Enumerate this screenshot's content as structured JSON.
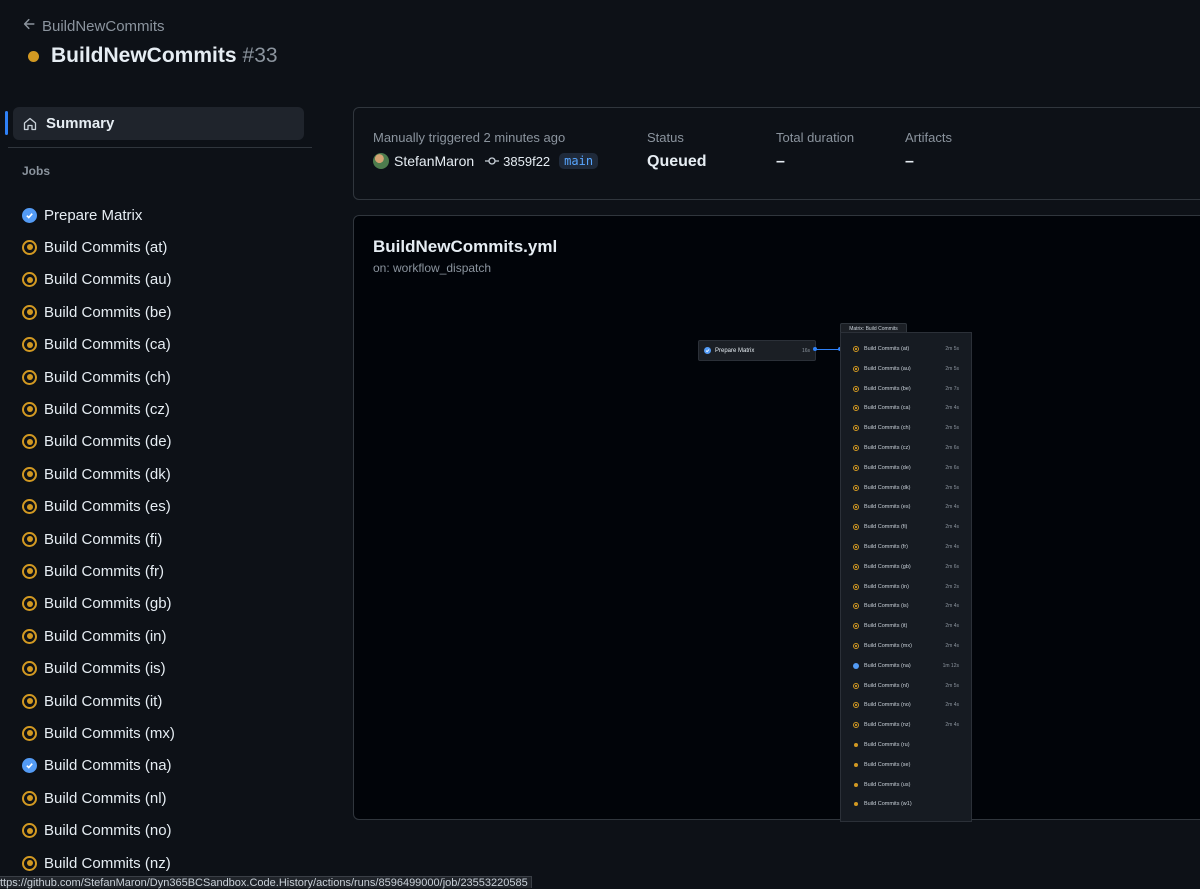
{
  "header": {
    "back_label": "BuildNewCommits",
    "title": "BuildNewCommits",
    "run_number": "#33"
  },
  "sidebar": {
    "summary_label": "Summary",
    "jobs_heading": "Jobs",
    "jobs": [
      {
        "label": "Prepare Matrix",
        "status": "success"
      },
      {
        "label": "Build Commits (at)",
        "status": "queued"
      },
      {
        "label": "Build Commits (au)",
        "status": "queued"
      },
      {
        "label": "Build Commits (be)",
        "status": "queued"
      },
      {
        "label": "Build Commits (ca)",
        "status": "queued"
      },
      {
        "label": "Build Commits (ch)",
        "status": "queued"
      },
      {
        "label": "Build Commits (cz)",
        "status": "queued"
      },
      {
        "label": "Build Commits (de)",
        "status": "queued"
      },
      {
        "label": "Build Commits (dk)",
        "status": "queued"
      },
      {
        "label": "Build Commits (es)",
        "status": "queued"
      },
      {
        "label": "Build Commits (fi)",
        "status": "queued"
      },
      {
        "label": "Build Commits (fr)",
        "status": "queued"
      },
      {
        "label": "Build Commits (gb)",
        "status": "queued"
      },
      {
        "label": "Build Commits (in)",
        "status": "queued"
      },
      {
        "label": "Build Commits (is)",
        "status": "queued"
      },
      {
        "label": "Build Commits (it)",
        "status": "queued"
      },
      {
        "label": "Build Commits (mx)",
        "status": "queued"
      },
      {
        "label": "Build Commits (na)",
        "status": "success"
      },
      {
        "label": "Build Commits (nl)",
        "status": "queued"
      },
      {
        "label": "Build Commits (no)",
        "status": "queued"
      },
      {
        "label": "Build Commits (nz)",
        "status": "queued"
      }
    ]
  },
  "summary": {
    "trigger_text": "Manually triggered 2 minutes ago",
    "actor": "StefanMaron",
    "commit": "3859f22",
    "branch": "main",
    "status_label": "Status",
    "status_value": "Queued",
    "duration_label": "Total duration",
    "duration_value": "–",
    "artifacts_label": "Artifacts",
    "artifacts_value": "–"
  },
  "graph": {
    "workflow_file": "BuildNewCommits.yml",
    "trigger": "on: workflow_dispatch",
    "prepare_node": {
      "label": "Prepare Matrix",
      "duration": "16s",
      "status": "success"
    },
    "matrix_title": "Matrix: Build Commits",
    "matrix_jobs": [
      {
        "label": "Build Commits (at)",
        "duration": "2m 5s",
        "status": "queued"
      },
      {
        "label": "Build Commits (au)",
        "duration": "2m 5s",
        "status": "queued"
      },
      {
        "label": "Build Commits (be)",
        "duration": "2m 7s",
        "status": "queued"
      },
      {
        "label": "Build Commits (ca)",
        "duration": "2m 4s",
        "status": "queued"
      },
      {
        "label": "Build Commits (ch)",
        "duration": "2m 5s",
        "status": "queued"
      },
      {
        "label": "Build Commits (cz)",
        "duration": "2m 6s",
        "status": "queued"
      },
      {
        "label": "Build Commits (de)",
        "duration": "2m 6s",
        "status": "queued"
      },
      {
        "label": "Build Commits (dk)",
        "duration": "2m 5s",
        "status": "queued"
      },
      {
        "label": "Build Commits (es)",
        "duration": "2m 4s",
        "status": "queued"
      },
      {
        "label": "Build Commits (fi)",
        "duration": "2m 4s",
        "status": "queued"
      },
      {
        "label": "Build Commits (fr)",
        "duration": "2m 4s",
        "status": "queued"
      },
      {
        "label": "Build Commits (gb)",
        "duration": "2m 6s",
        "status": "queued"
      },
      {
        "label": "Build Commits (in)",
        "duration": "2m 2s",
        "status": "queued"
      },
      {
        "label": "Build Commits (is)",
        "duration": "2m 4s",
        "status": "queued"
      },
      {
        "label": "Build Commits (it)",
        "duration": "2m 4s",
        "status": "queued"
      },
      {
        "label": "Build Commits (mx)",
        "duration": "2m 4s",
        "status": "queued"
      },
      {
        "label": "Build Commits (na)",
        "duration": "1m 12s",
        "status": "success"
      },
      {
        "label": "Build Commits (nl)",
        "duration": "2m 5s",
        "status": "queued"
      },
      {
        "label": "Build Commits (no)",
        "duration": "2m 4s",
        "status": "queued"
      },
      {
        "label": "Build Commits (nz)",
        "duration": "2m 4s",
        "status": "queued"
      },
      {
        "label": "Build Commits (ru)",
        "duration": "",
        "status": "pending"
      },
      {
        "label": "Build Commits (se)",
        "duration": "",
        "status": "pending"
      },
      {
        "label": "Build Commits (us)",
        "duration": "",
        "status": "pending"
      },
      {
        "label": "Build Commits (w1)",
        "duration": "",
        "status": "pending"
      }
    ]
  },
  "status_bar": {
    "url": "ttps://github.com/StefanMaron/Dyn365BCSandbox.Code.History/actions/runs/8596499000/job/23553220585"
  },
  "colors": {
    "background": "#0d1117",
    "queued": "#d29922",
    "success": "#539bf5",
    "accent": "#2f81f7"
  }
}
